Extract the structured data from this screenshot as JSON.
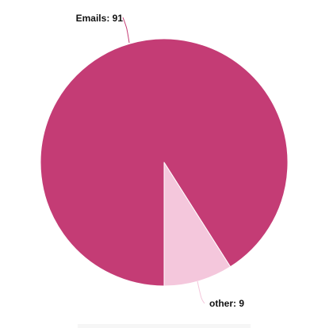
{
  "chart_data": {
    "type": "pie",
    "title": "",
    "slices": [
      {
        "label": "Emails",
        "value": 91,
        "color": "#c43c75"
      },
      {
        "label": "other",
        "value": 9,
        "color": "#f4c7dc"
      }
    ]
  }
}
